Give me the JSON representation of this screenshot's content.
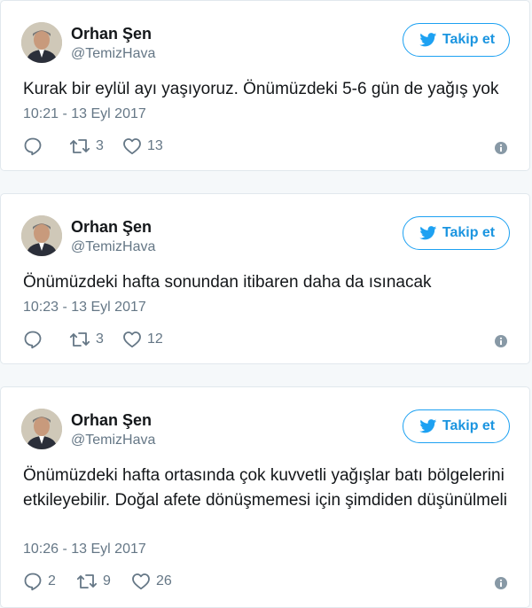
{
  "tweets": [
    {
      "author": {
        "name": "Orhan Şen",
        "handle": "@TemizHava"
      },
      "follow_label": "Takip et",
      "text": "Kurak bir eylül ayı yaşıyoruz. Önümüzdeki 5-6 gün de yağış yok",
      "timestamp": "10:21 - 13 Eyl 2017",
      "replies": "",
      "retweets": "3",
      "likes": "13"
    },
    {
      "author": {
        "name": "Orhan Şen",
        "handle": "@TemizHava"
      },
      "follow_label": "Takip et",
      "text": "Önümüzdeki hafta sonundan itibaren daha da ısınacak",
      "timestamp": "10:23 - 13 Eyl 2017",
      "replies": "",
      "retweets": "3",
      "likes": "12"
    },
    {
      "author": {
        "name": "Orhan Şen",
        "handle": "@TemizHava"
      },
      "follow_label": "Takip et",
      "text": "Önümüzdeki hafta ortasında çok kuvvetli yağışlar batı bölgelerini etkileyebilir. Doğal afete dönüşmemesi için şimdiden düşünülmeli",
      "timestamp": "10:26 - 13 Eyl 2017",
      "replies": "2",
      "retweets": "9",
      "likes": "26"
    }
  ],
  "colors": {
    "twitter_blue": "#1da1f2",
    "follow_text": "#1b95e0",
    "secondary_text": "#657786",
    "border": "#e1e8ed",
    "info_icon": "#8899a6"
  },
  "icons": [
    "twitter-bird-icon",
    "reply-icon",
    "retweet-icon",
    "like-icon",
    "info-icon"
  ]
}
